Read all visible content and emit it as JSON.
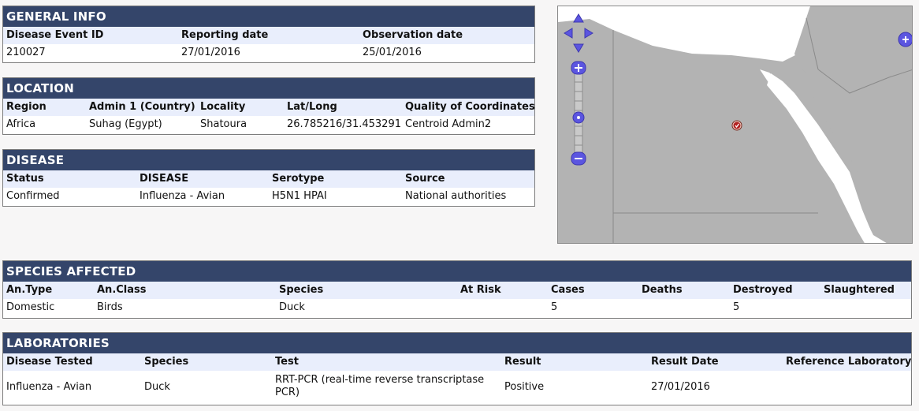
{
  "general": {
    "title": "GENERAL INFO",
    "headers": [
      "Disease Event ID",
      "Reporting date",
      "Observation date"
    ],
    "values": [
      "210027",
      "27/01/2016",
      "25/01/2016"
    ]
  },
  "location": {
    "title": "LOCATION",
    "headers": [
      "Region",
      "Admin 1 (Country)",
      "Locality",
      "Lat/Long",
      "Quality of Coordinates"
    ],
    "values": [
      "Africa",
      "Suhag (Egypt)",
      "Shatoura",
      "26.785216/31.453291",
      "Centroid Admin2"
    ]
  },
  "disease": {
    "title": "DISEASE",
    "headers": [
      "Status",
      "DISEASE",
      "Serotype",
      "Source"
    ],
    "values": [
      "Confirmed",
      "Influenza - Avian",
      "H5N1 HPAI",
      "National authorities"
    ]
  },
  "species": {
    "title": "SPECIES AFFECTED",
    "headers": [
      "An.Type",
      "An.Class",
      "Species",
      "At Risk",
      "Cases",
      "Deaths",
      "Destroyed",
      "Slaughtered"
    ],
    "values": [
      "Domestic",
      "Birds",
      "Duck",
      "",
      "5",
      "",
      "5",
      ""
    ]
  },
  "laboratories": {
    "title": "LABORATORIES",
    "headers": [
      "Disease Tested",
      "Species",
      "Test",
      "Result",
      "Result Date",
      "Reference Laboratory"
    ],
    "values": [
      "Influenza - Avian",
      "Duck",
      "RRT-PCR (real-time reverse transcriptase PCR)",
      "Positive",
      "27/01/2016",
      ""
    ]
  },
  "map": {
    "land_color": "#b3b3b3",
    "water_color": "#ffffff",
    "control_color": "#5b55e0",
    "marker_color": "#b22222"
  }
}
